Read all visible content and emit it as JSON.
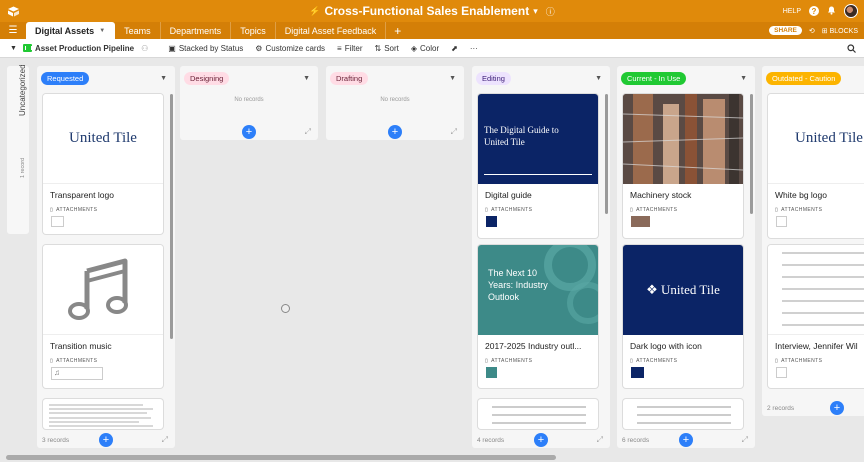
{
  "app": {
    "title": "Cross-Functional Sales Enablement",
    "help_label": "HELP",
    "share_label": "SHARE",
    "blocks_label": "BLOCKS"
  },
  "tabs": [
    "Digital Assets",
    "Teams",
    "Departments",
    "Topics",
    "Digital Asset Feedback"
  ],
  "view": {
    "name": "Asset Production Pipeline",
    "stacked": "Stacked by Status",
    "customize": "Customize cards",
    "filter": "Filter",
    "sort": "Sort",
    "color": "Color"
  },
  "uncategorized": {
    "label": "Uncategorized",
    "count": "1 record"
  },
  "columns": [
    {
      "name": "Requested",
      "color": "#2d7ff9",
      "text": "#ffffff",
      "footer": "3 records"
    },
    {
      "name": "Designing",
      "color": "#ffdce5",
      "text": "#6b2137",
      "footer": "No records"
    },
    {
      "name": "Drafting",
      "color": "#ffdce5",
      "text": "#6b2137",
      "footer": "No records"
    },
    {
      "name": "Editing",
      "color": "#ede3fe",
      "text": "#3c1c78",
      "footer": "4 records"
    },
    {
      "name": "Current - In Use",
      "color": "#20c933",
      "text": "#ffffff",
      "footer": "6 records"
    },
    {
      "name": "Outdated - Caution",
      "color": "#fcb400",
      "text": "#ffffff",
      "footer": "2 records"
    }
  ],
  "cards": {
    "requested_1": {
      "title": "Transparent logo",
      "image_text": "United Tile"
    },
    "requested_2": {
      "title": "Transition music"
    },
    "editing_1": {
      "title": "Digital guide",
      "image_text": "The Digital Guide to United Tile"
    },
    "editing_2": {
      "title": "2017-2025 Industry outl...",
      "image_text": "The Next 10 Years: Industry Outlook"
    },
    "current_1": {
      "title": "Machinery stock"
    },
    "current_2": {
      "title": "Dark logo with icon",
      "image_text": "❖ United Tile"
    },
    "outdated_1": {
      "title": "White bg logo",
      "image_text": "United Tile"
    },
    "outdated_2": {
      "title": "Interview, Jennifer Wil"
    }
  },
  "attachments_label": "ATTACHMENTS"
}
